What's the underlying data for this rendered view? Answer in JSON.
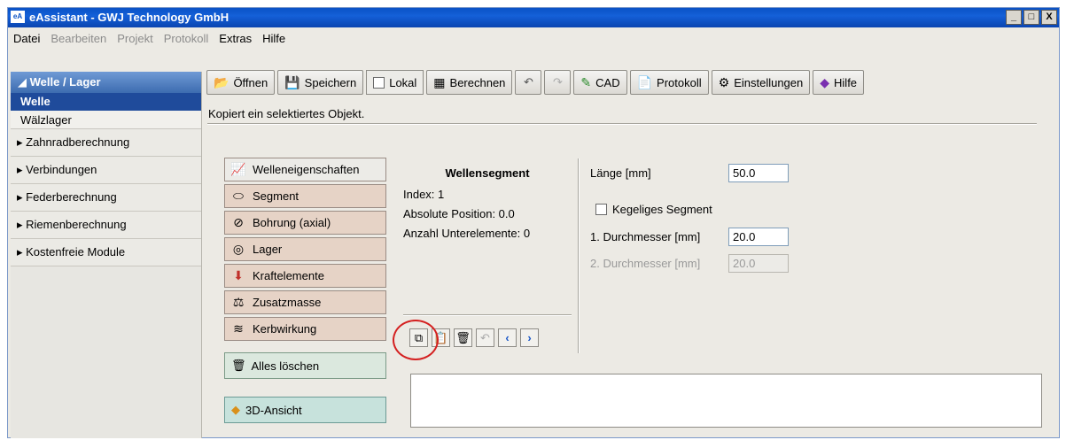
{
  "window": {
    "title": "eAssistant - GWJ Technology GmbH",
    "app_icon": "eA",
    "controls": [
      "_",
      "□",
      "X"
    ]
  },
  "menubar": [
    {
      "label": "Datei",
      "enabled": true
    },
    {
      "label": "Bearbeiten",
      "enabled": false
    },
    {
      "label": "Projekt",
      "enabled": false
    },
    {
      "label": "Protokoll",
      "enabled": false
    },
    {
      "label": "Extras",
      "enabled": true
    },
    {
      "label": "Hilfe",
      "enabled": true
    }
  ],
  "sidebar": {
    "group": "◢ Welle / Lager",
    "selected": "Welle",
    "sub_items": [
      "Wälzlager"
    ],
    "categories": [
      "Zahnradberechnung",
      "Verbindungen",
      "Federberechnung",
      "Riemenberechnung",
      "Kostenfreie Module"
    ]
  },
  "toolbar": {
    "open": "Öffnen",
    "save": "Speichern",
    "local": "Lokal",
    "calculate": "Berechnen",
    "undo": "↶",
    "redo": "↷",
    "cad": "CAD",
    "protocol": "Protokoll",
    "settings": "Einstellungen",
    "help": "Hilfe"
  },
  "status_text": "Kopiert ein selektiertes Objekt.",
  "left_buttons": [
    {
      "label": "Welleneigenschaften",
      "icon": "chart-icon"
    },
    {
      "label": "Segment",
      "icon": "segment-icon"
    },
    {
      "label": "Bohrung (axial)",
      "icon": "bore-icon"
    },
    {
      "label": "Lager",
      "icon": "bearing-icon"
    },
    {
      "label": "Kraftelemente",
      "icon": "force-icon"
    },
    {
      "label": "Zusatzmasse",
      "icon": "weight-icon"
    },
    {
      "label": "Kerbwirkung",
      "icon": "notch-icon"
    }
  ],
  "clear_all": "Alles löschen",
  "view_3d": "3D-Ansicht",
  "segment": {
    "title": "Wellensegment",
    "index": "Index: 1",
    "abs_position": "Absolute Position:  0.0",
    "sub_count": "Anzahl Unterelemente: 0"
  },
  "properties": {
    "length_label": "Länge [mm]",
    "length_value": "50.0",
    "conical_label": "Kegeliges Segment",
    "d1_label": "1. Durchmesser [mm]",
    "d1_value": "20.0",
    "d2_label": "2. Durchmesser [mm]",
    "d2_value": "20.0"
  },
  "accent": {
    "title_blue": "#0a52c6",
    "selected_blue": "#1f4b9b",
    "highlight_ring": "#d42020"
  }
}
